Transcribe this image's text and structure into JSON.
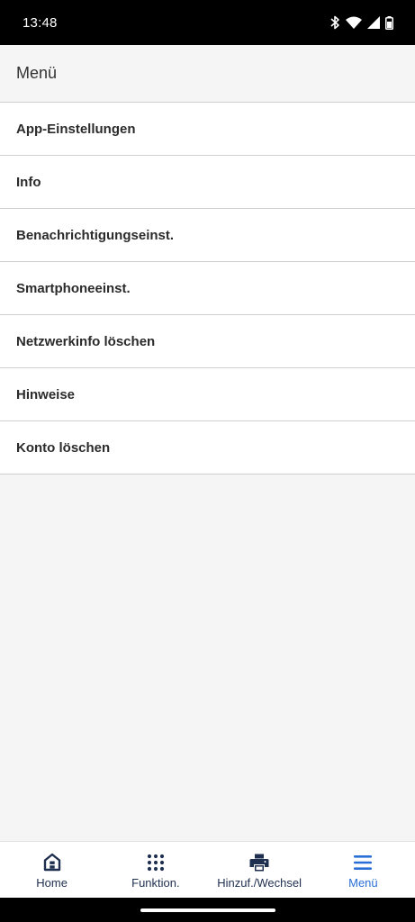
{
  "status_bar": {
    "time": "13:48",
    "icons": [
      "bluetooth-icon",
      "wifi-icon",
      "signal-icon",
      "battery-icon"
    ]
  },
  "header": {
    "title": "Menü"
  },
  "menu": {
    "items": [
      {
        "label": "App-Einstellungen"
      },
      {
        "label": "Info"
      },
      {
        "label": "Benachrichtigungseinst."
      },
      {
        "label": "Smartphoneeinst."
      },
      {
        "label": "Netzwerkinfo löschen"
      },
      {
        "label": "Hinweise"
      },
      {
        "label": "Konto löschen"
      }
    ]
  },
  "bottom_nav": {
    "items": [
      {
        "label": "Home",
        "icon": "home-icon"
      },
      {
        "label": "Funktion.",
        "icon": "grid-dots-icon"
      },
      {
        "label": "Hinzuf./Wechsel",
        "icon": "printer-icon"
      },
      {
        "label": "Menü",
        "icon": "hamburger-menu-icon",
        "active": true
      }
    ]
  },
  "colors": {
    "accent": "#2a6fd6",
    "nav_icon": "#1f2f4f",
    "background": "#f5f5f5",
    "divider": "#cfcfcf"
  }
}
